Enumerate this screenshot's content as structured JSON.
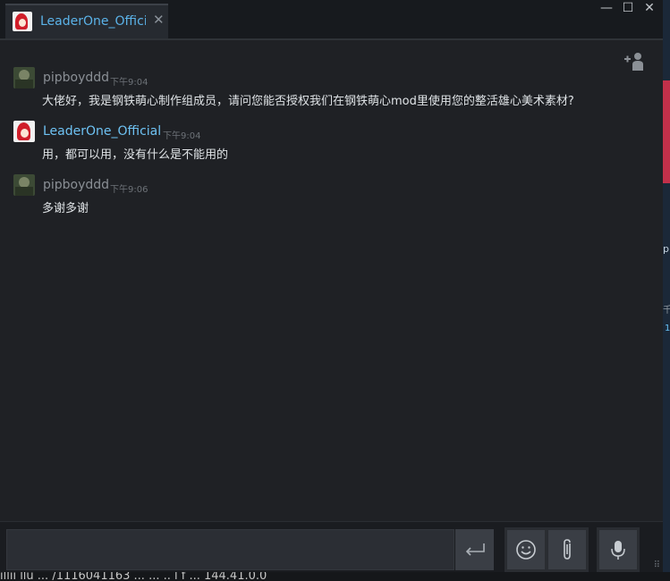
{
  "window": {
    "tab_label": "LeaderOne_Officia",
    "tab_close_glyph": "✕",
    "minimize_glyph": "—",
    "maximize_glyph": "☐",
    "close_glyph": "✕"
  },
  "messages": [
    {
      "author": "pipboyddd",
      "time": "下午9:04",
      "text": "大佬好，我是钢铁萌心制作组成员，请问您能否授权我们在钢铁萌心mod里使用您的整活雄心美术素材?"
    },
    {
      "author": "LeaderOne_Official",
      "time": "下午9:04",
      "text": "用，都可以用，没有什么是不能用的"
    },
    {
      "author": "pipboyddd",
      "time": "下午9:06",
      "text": "多谢多谢"
    }
  ],
  "input": {
    "value": "",
    "placeholder": ""
  },
  "background": {
    "text1": "pl",
    "text2": "千",
    "text3": "1",
    "bottom_text": "illii  llu  ...  /1116041163  ...  ...  .. l  f  ...  144.41.0.0"
  },
  "icons": {
    "invite": "invite-friend-icon",
    "send": "enter-icon",
    "emoji": "emoji-icon",
    "attach": "paperclip-icon",
    "voice": "microphone-icon"
  },
  "colors": {
    "accent": "#6ec2f3",
    "window_bg": "#1f2125",
    "titlebar_bg": "#171a1e"
  }
}
